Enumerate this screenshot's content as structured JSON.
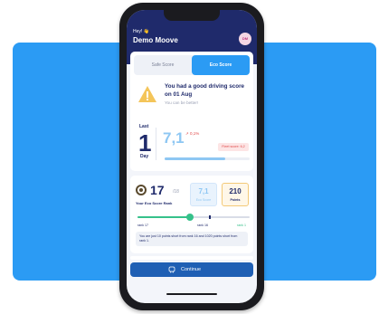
{
  "header": {
    "greeting": "Hey! 👋",
    "user_name": "Demo Moove",
    "avatar_initials": "DM"
  },
  "tabs": [
    {
      "label": "Safe Score",
      "active": false
    },
    {
      "label": "Eco Score",
      "active": true
    }
  ],
  "message": {
    "title": "You had a good driving score on 01 Aug",
    "subtitle": "You can be better!"
  },
  "last_period": {
    "label_top": "Last",
    "number": "1",
    "label_bottom": "Day"
  },
  "score": {
    "value": "7,1",
    "trend": "↗ 0,1%",
    "fleet_label": "Fleet score: 6,2",
    "progress": 0.71
  },
  "rank": {
    "position": "17",
    "total": "/18",
    "label": "Your Eco Score Rank",
    "eco_box_value": "7,1",
    "eco_box_label": "Eco Score",
    "points_value": "210",
    "points_label": "Points",
    "slider_progress": 0.47,
    "rank_left": "rank 17",
    "rank_mid": "rank 16",
    "rank_right": "rank 1",
    "info_text": "You are just 10 points short from rank 16 and 1020 points short from rank 1."
  },
  "continue_label": "Continue",
  "colors": {
    "accent": "#2b9bf4",
    "navy": "#1f2a6b",
    "green": "#35c18a",
    "red": "#e04848"
  }
}
